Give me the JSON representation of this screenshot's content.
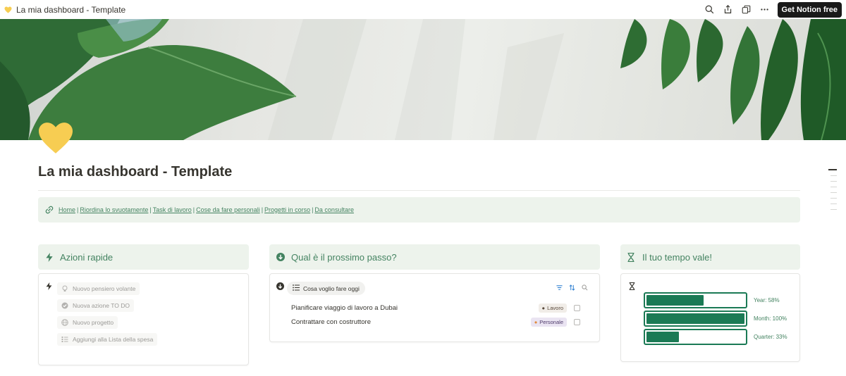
{
  "tab": {
    "title": "La mia dashboard - Template"
  },
  "topbar": {
    "cta_label": "Get Notion free",
    "icons": [
      "search-icon",
      "share-icon",
      "duplicate-icon",
      "more-icon"
    ]
  },
  "page": {
    "title": "La mia dashboard - Template",
    "icon": "yellow-heart-icon"
  },
  "nav": {
    "links": [
      "Home",
      "Riordina lo svuotamente",
      "Task di lavoro",
      "Cose da fare personali",
      "Progetti in corso",
      "Da consultare"
    ]
  },
  "columns": {
    "quick_actions": {
      "title": "Azioni rapide",
      "items": [
        {
          "label": "Nuovo pensiero volante",
          "icon": "lightbulb-icon"
        },
        {
          "label": "Nuova azione TO DO",
          "icon": "check-circle-icon"
        },
        {
          "label": "Nuovo progetto",
          "icon": "globe-icon"
        },
        {
          "label": "Aggiungi alla Lista della spesa",
          "icon": "list-icon"
        }
      ]
    },
    "next_step": {
      "title": "Qual è il prossimo passo?",
      "view_label": "Cosa voglio fare oggi",
      "tasks": [
        {
          "name": "Pianificare viaggio di lavoro a Dubai",
          "tag": "Lavoro",
          "tag_icon": "person-icon"
        },
        {
          "name": "Contrattare con costruttore",
          "tag": "Personale",
          "tag_icon": "hand-icon"
        }
      ]
    },
    "time": {
      "title": "Il tuo tempo vale!",
      "bars": [
        {
          "label": "Year: 58%",
          "value": 0.58
        },
        {
          "label": "Month: 100%",
          "value": 1.0
        },
        {
          "label": "Quarter: 33%",
          "value": 0.33
        }
      ]
    }
  },
  "colors": {
    "accent_green": "#448361",
    "callout_bg": "#edf3ec",
    "bar_green": "#1b7a55",
    "heart_yellow": "#f7cd52"
  }
}
